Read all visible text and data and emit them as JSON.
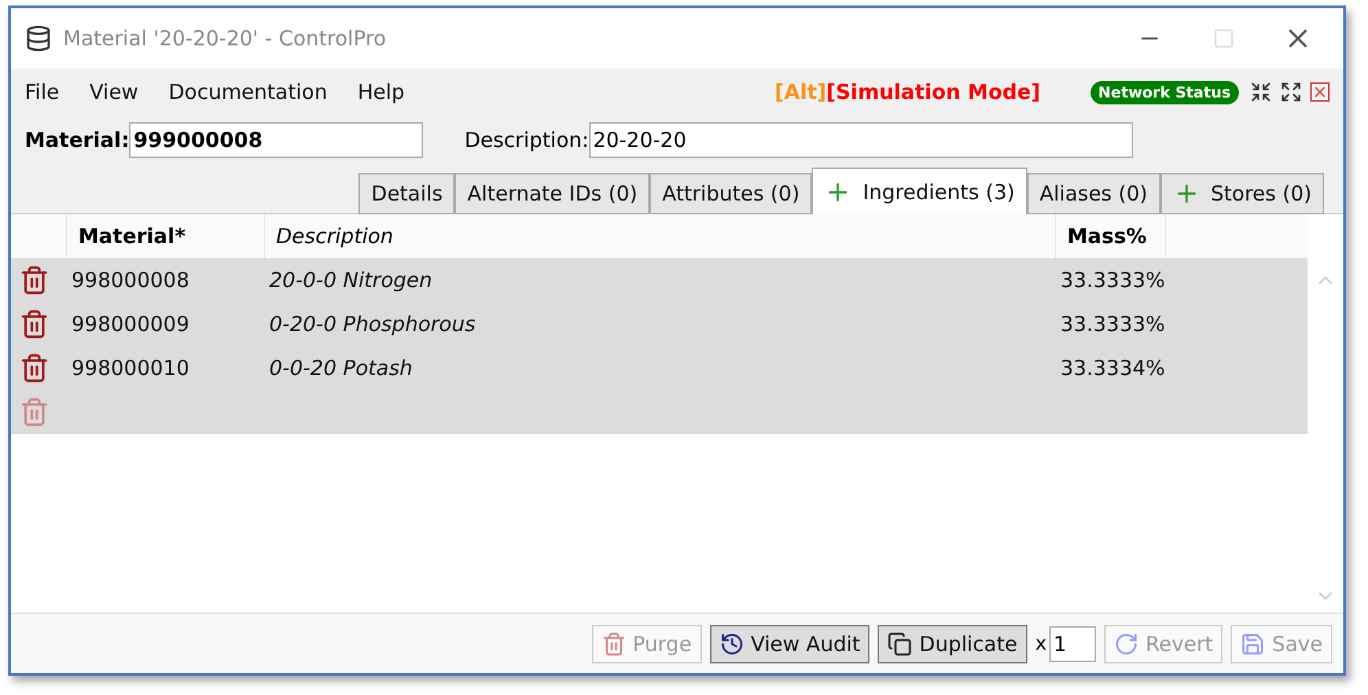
{
  "window": {
    "title": "Material '20-20-20' - ControlPro"
  },
  "menu": [
    "File",
    "View",
    "Documentation",
    "Help"
  ],
  "mode": {
    "alt": "[Alt]",
    "simulation": "[Simulation Mode]",
    "network_status": "Network Status"
  },
  "fields": {
    "material_label": "Material:",
    "material_value": "999000008",
    "description_label": "Description:",
    "description_value": "20-20-20"
  },
  "tabs": [
    {
      "label": "Details",
      "selected": false,
      "has_add": false
    },
    {
      "label": "Alternate IDs (0)",
      "selected": false,
      "has_add": false
    },
    {
      "label": "Attributes (0)",
      "selected": false,
      "has_add": false
    },
    {
      "label": "Ingredients (3)",
      "selected": true,
      "has_add": true
    },
    {
      "label": "Aliases (0)",
      "selected": false,
      "has_add": false
    },
    {
      "label": "Stores (0)",
      "selected": false,
      "has_add": true
    }
  ],
  "table": {
    "columns": [
      "Material*",
      "Description",
      "Mass%"
    ],
    "rows": [
      {
        "material": "998000008",
        "description": "20-0-0 Nitrogen",
        "mass": "33.3333%",
        "delete_enabled": true
      },
      {
        "material": "998000009",
        "description": "0-20-0 Phosphorous",
        "mass": "33.3333%",
        "delete_enabled": true
      },
      {
        "material": "998000010",
        "description": "0-0-20 Potash",
        "mass": "33.3334%",
        "delete_enabled": true
      }
    ],
    "blank_row": {
      "delete_enabled": false
    }
  },
  "footer": {
    "buttons": [
      {
        "kind": "purge",
        "label": "Purge",
        "disabled": true
      },
      {
        "kind": "audit",
        "label": "View Audit",
        "disabled": false
      },
      {
        "kind": "duplicate",
        "label": "Duplicate",
        "disabled": false
      }
    ],
    "times_label": "x",
    "times_value": "1",
    "buttons_after": [
      {
        "kind": "revert",
        "label": "Revert",
        "disabled": true
      },
      {
        "kind": "save",
        "label": "Save",
        "disabled": true
      }
    ]
  }
}
